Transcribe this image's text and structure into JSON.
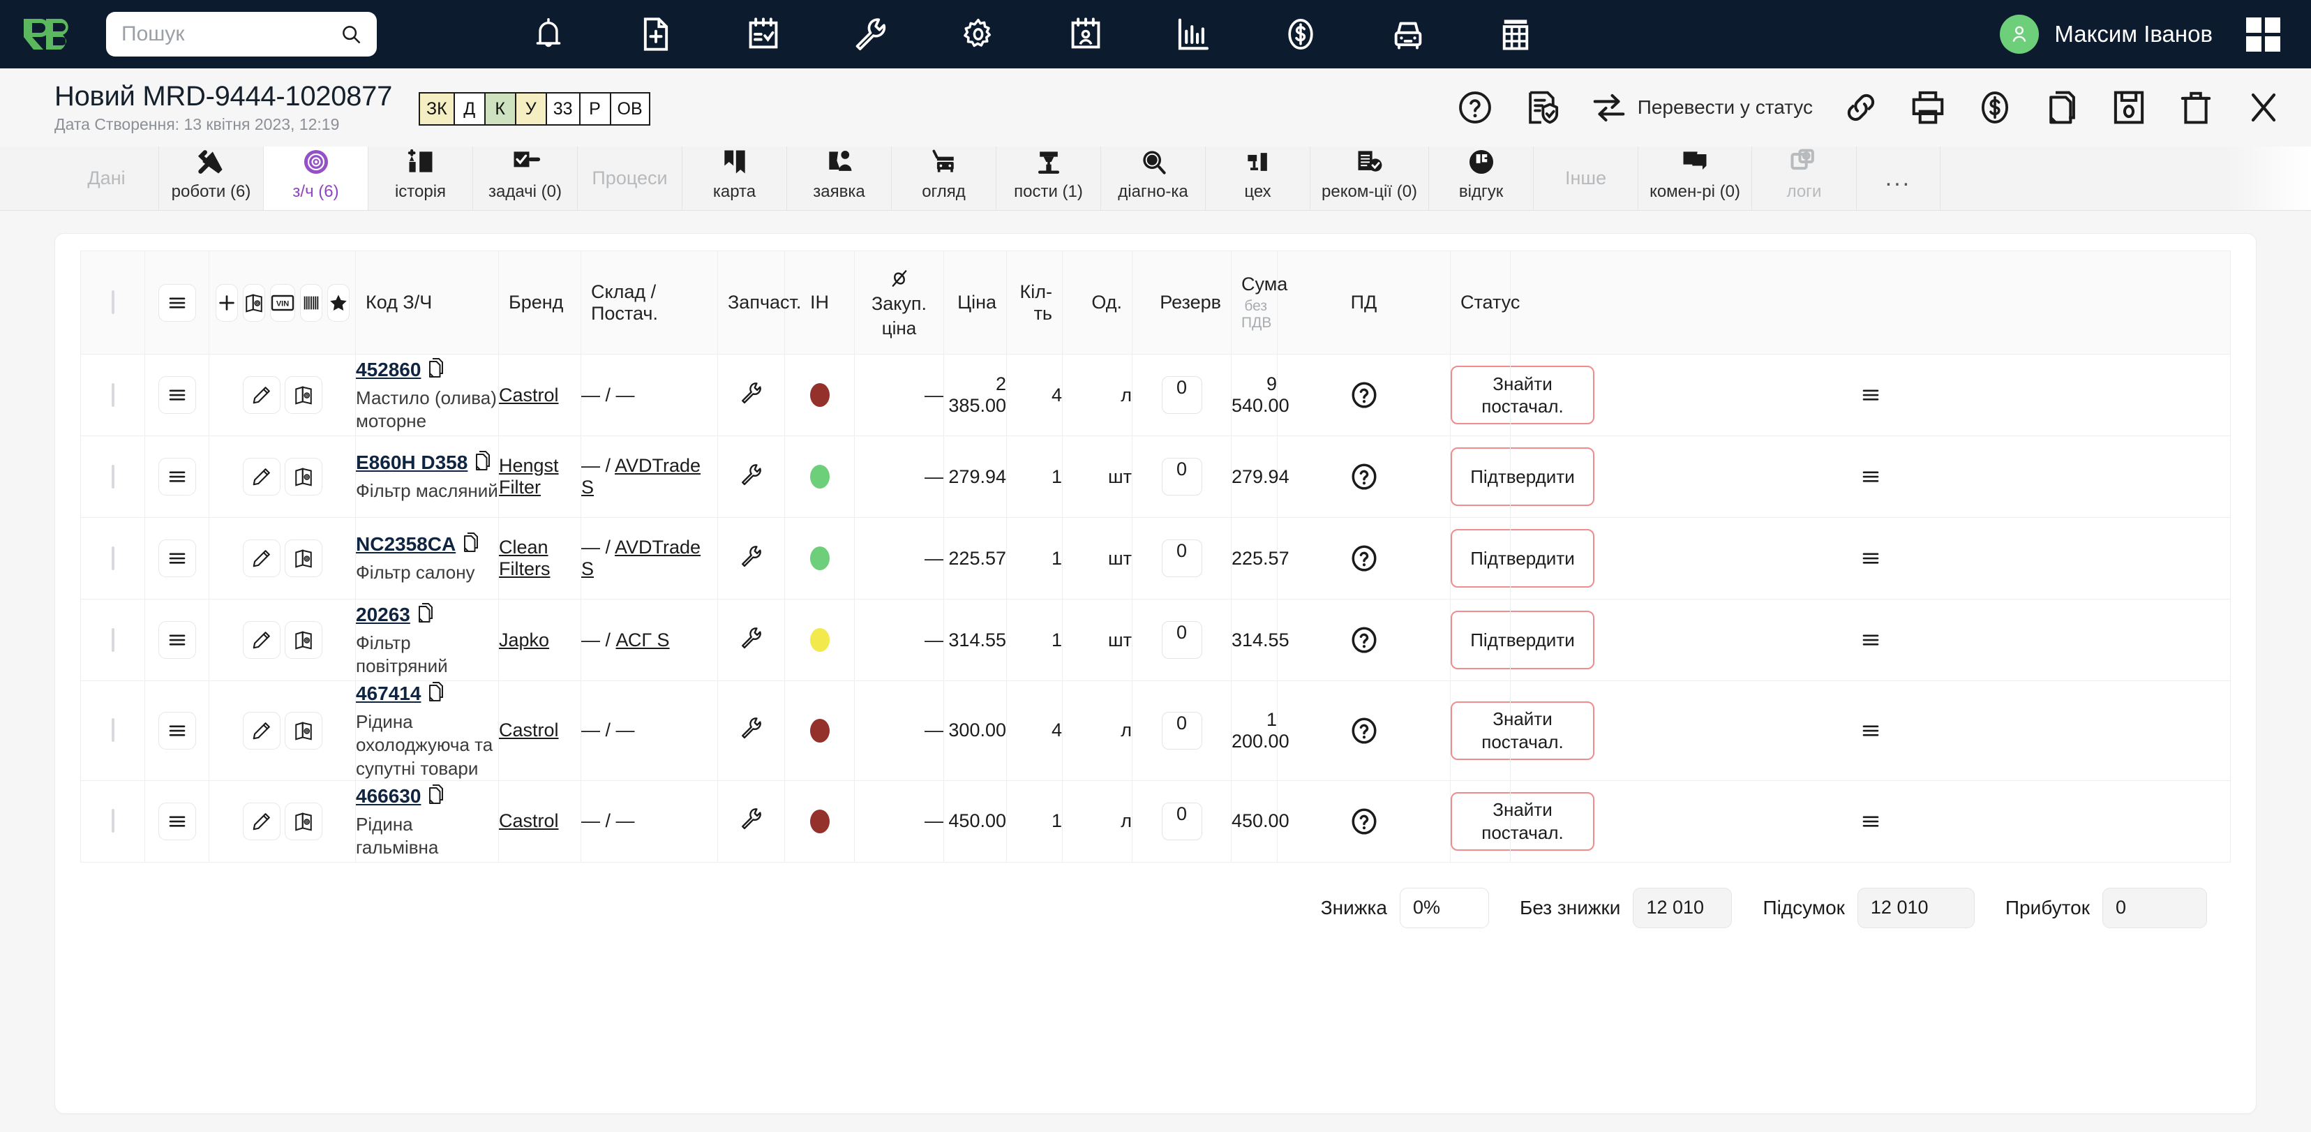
{
  "topnav": {
    "logo_alt": "RB logo",
    "search_placeholder": "Пошук",
    "icons": [
      "bell-icon",
      "new-document-icon",
      "checklist-calendar-icon",
      "wrench-icon",
      "gear-icon",
      "person-calendar-icon",
      "bar-chart-icon",
      "dollar-coin-icon",
      "car-icon",
      "table-icon"
    ],
    "user_name": "Максим Іванов"
  },
  "dochead": {
    "title": "Новий MRD-9444-1020877",
    "subtitle": "Дата Створення: 13 квітня 2023, 12:19",
    "badges": [
      {
        "label": "ЗК",
        "bg": "#f5eec2"
      },
      {
        "label": "Д",
        "bg": "#ffffff"
      },
      {
        "label": "К",
        "bg": "#cfe2c0"
      },
      {
        "label": "У",
        "bg": "#f5eec2"
      },
      {
        "label": "33",
        "bg": "#ffffff"
      },
      {
        "label": "Р",
        "bg": "#ffffff"
      },
      {
        "label": "ОВ",
        "bg": "#ffffff"
      }
    ],
    "status_action_label": "Перевести у статус",
    "actions": [
      "help-icon",
      "document-check-icon",
      "transfer-status-icon",
      "link-icon",
      "print-icon",
      "dollar-icon",
      "copy-icon",
      "save-icon",
      "trash-icon",
      "close-icon"
    ]
  },
  "tabs": [
    {
      "label": "Дані",
      "type": "group"
    },
    {
      "label": "роботи (6)",
      "icon": "tools-icon",
      "active": false
    },
    {
      "label": "з/ч (6)",
      "icon": "brake-disc-icon",
      "active": true
    },
    {
      "label": "історія",
      "icon": "history-icon",
      "active": false
    },
    {
      "label": "задачі (0)",
      "icon": "tasks-icon",
      "active": false
    },
    {
      "label": "Процеси",
      "type": "group"
    },
    {
      "label": "карта",
      "icon": "map-icon",
      "active": false
    },
    {
      "label": "заявка",
      "icon": "request-icon",
      "active": false
    },
    {
      "label": "огляд",
      "icon": "inspection-icon",
      "active": false
    },
    {
      "label": "пости (1)",
      "icon": "lift-icon",
      "active": false
    },
    {
      "label": "діагно-ка",
      "icon": "diagnostics-icon",
      "active": false
    },
    {
      "label": "цех",
      "icon": "workshop-icon",
      "active": false
    },
    {
      "label": "реком-ції (0)",
      "icon": "recommendations-icon",
      "active": false
    },
    {
      "label": "відгук",
      "icon": "feedback-icon",
      "active": false
    },
    {
      "label": "Інше",
      "type": "group"
    },
    {
      "label": "комен-рі (0)",
      "icon": "comments-icon",
      "active": false
    },
    {
      "label": "логи",
      "icon": "logs-icon",
      "active": false,
      "muted": true
    },
    {
      "label": "...",
      "type": "dots"
    }
  ],
  "table": {
    "toolbar": [
      "add-icon",
      "catalog-icon",
      "vin-icon",
      "barcode-icon",
      "star-icon"
    ],
    "headers": {
      "code": "Код З/Ч",
      "brand": "Бренд",
      "stock": "Склад / Постач.",
      "part": "Запчаст.",
      "in": "ІН",
      "purchase": "Закуп.",
      "purchase_sub": "ціна",
      "price": "Ціна",
      "qty": "Кіл-\nть",
      "unit": "Од.",
      "reserve": "Резерв",
      "sum": "Сума",
      "sum_sub": "без ПДВ",
      "pd": "ПД",
      "status": "Статус"
    },
    "rows": [
      {
        "code": "452860",
        "desc": "Мастило (олива) моторне",
        "brand": "Castrol",
        "brand_link": true,
        "stock": "— / —",
        "stock_link": "",
        "dot": "#93312a",
        "purchase": "—",
        "price": "2 385.00",
        "qty": "4",
        "unit": "л",
        "reserve": "0",
        "sum": "9 540.00",
        "status": "Знайти постачал."
      },
      {
        "code": "E860H D358",
        "desc": "Фільтр масляний",
        "brand": "Hengst Filter",
        "brand_link": true,
        "stock": "— / ",
        "stock_link": "AVDTrade S",
        "dot": "#6dcf7a",
        "purchase": "—",
        "price": "279.94",
        "qty": "1",
        "unit": "шт",
        "reserve": "0",
        "sum": "279.94",
        "status": "Підтвердити"
      },
      {
        "code": "NC2358CA",
        "desc": "Фільтр салону",
        "brand": "Clean Filters",
        "brand_link": true,
        "stock": "— / ",
        "stock_link": "AVDTrade S",
        "dot": "#6dcf7a",
        "purchase": "—",
        "price": "225.57",
        "qty": "1",
        "unit": "шт",
        "reserve": "0",
        "sum": "225.57",
        "status": "Підтвердити"
      },
      {
        "code": "20263",
        "desc": "Фільтр повітряний",
        "brand": "Japko",
        "brand_link": true,
        "stock": "— / ",
        "stock_link": "АСГ S",
        "dot": "#f2ea4c",
        "purchase": "—",
        "price": "314.55",
        "qty": "1",
        "unit": "шт",
        "reserve": "0",
        "sum": "314.55",
        "status": "Підтвердити"
      },
      {
        "code": "467414",
        "desc": "Рідина охолоджуюча та супутні товари",
        "brand": "Castrol",
        "brand_link": true,
        "stock": "— / —",
        "stock_link": "",
        "dot": "#93312a",
        "purchase": "—",
        "price": "300.00",
        "qty": "4",
        "unit": "л",
        "reserve": "0",
        "sum": "1 200.00",
        "status": "Знайти постачал."
      },
      {
        "code": "466630",
        "desc": "Рідина гальмівна",
        "brand": "Castrol",
        "brand_link": true,
        "stock": "— / —",
        "stock_link": "",
        "dot": "#93312a",
        "purchase": "—",
        "price": "450.00",
        "qty": "1",
        "unit": "л",
        "reserve": "0",
        "sum": "450.00",
        "status": "Знайти постачал."
      }
    ]
  },
  "footer": {
    "discount_label": "Знижка",
    "discount_value": "0%",
    "nodiscount_label": "Без знижки",
    "nodiscount_value": "12 010",
    "subtotal_label": "Підсумок",
    "subtotal_value": "12 010",
    "profit_label": "Прибуток",
    "profit_value": "0"
  },
  "colors": {
    "navy": "#0d1b2e",
    "green": "#5bb85f",
    "purple": "#8e46c0",
    "red_border": "#ef8c8c"
  }
}
